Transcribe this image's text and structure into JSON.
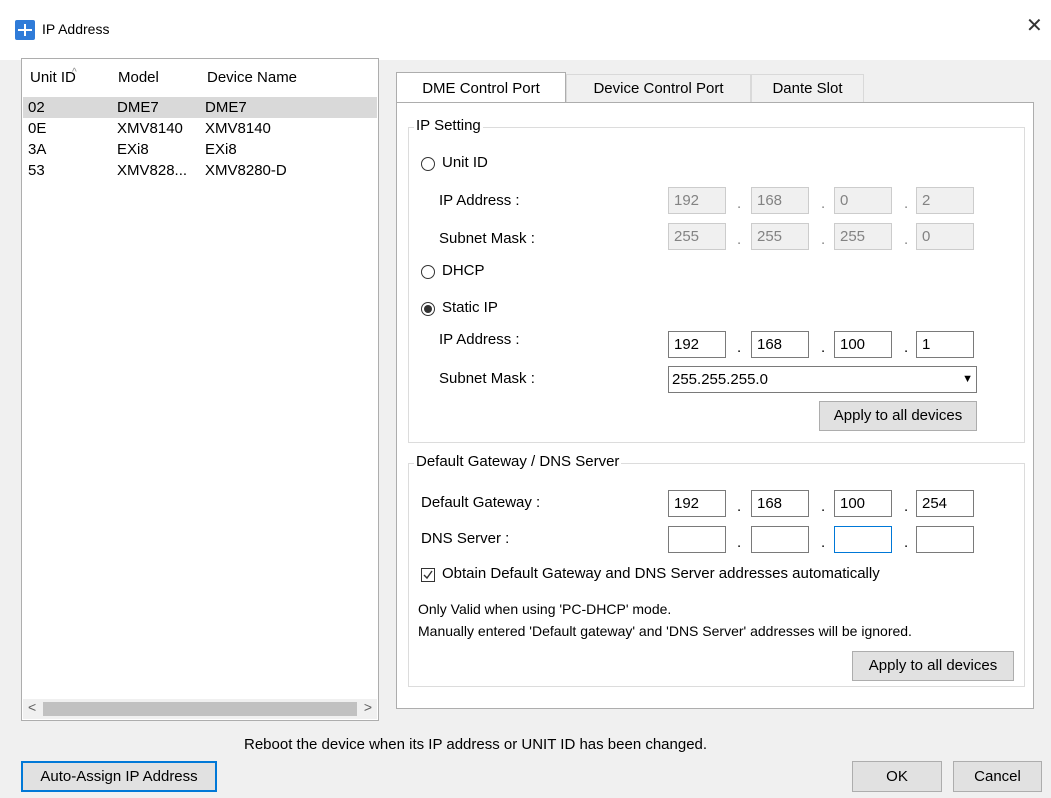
{
  "window": {
    "title": "IP Address",
    "close_glyph": "✕"
  },
  "list": {
    "headers": {
      "unit_id": "Unit ID",
      "model": "Model",
      "device_name": "Device Name"
    },
    "rows": [
      {
        "unit_id": "02",
        "model": "DME7",
        "device_name": "DME7",
        "selected": true
      },
      {
        "unit_id": "0E",
        "model": "XMV8140",
        "device_name": "XMV8140"
      },
      {
        "unit_id": "3A",
        "model": "EXi8",
        "device_name": "EXi8"
      },
      {
        "unit_id": "53",
        "model": "XMV828...",
        "device_name": "XMV8280-D"
      }
    ],
    "scroll_left": "<",
    "scroll_right": ">"
  },
  "tabs": [
    "DME Control Port",
    "Device Control Port",
    "Dante Slot"
  ],
  "ip_setting": {
    "legend": "IP Setting",
    "unit_id_label": "Unit ID",
    "unit_id_ip_label": "IP Address :",
    "unit_id_ip": [
      "192",
      "168",
      "0",
      "2"
    ],
    "unit_id_mask_label": "Subnet Mask :",
    "unit_id_mask": [
      "255",
      "255",
      "255",
      "0"
    ],
    "dhcp_label": "DHCP",
    "static_label": "Static IP",
    "static_ip_label": "IP Address :",
    "static_ip": [
      "192",
      "168",
      "100",
      "1"
    ],
    "static_mask_label": "Subnet Mask :",
    "static_mask": "255.255.255.0",
    "apply_label": "Apply to all devices",
    "selected_mode": "Static IP"
  },
  "gateway": {
    "legend": "Default Gateway / DNS Server",
    "gateway_label": "Default Gateway :",
    "gateway_ip": [
      "192",
      "168",
      "100",
      "254"
    ],
    "dns_label": "DNS Server :",
    "dns_ip": [
      "",
      "",
      "",
      ""
    ],
    "auto_label": "Obtain Default Gateway and DNS Server addresses automatically",
    "auto_checked": true,
    "note1": "Only Valid when using 'PC-DHCP' mode.",
    "note2": "Manually entered 'Default gateway' and 'DNS Server' addresses will be ignored.",
    "apply_label": "Apply to all devices"
  },
  "footer": {
    "reboot_note": "Reboot the device when its IP address or UNIT ID has been changed.",
    "auto_assign_label": "Auto-Assign IP Address",
    "ok_label": "OK",
    "cancel_label": "Cancel"
  },
  "colors": {
    "accent": "#0078d7",
    "selected_row": "#d9d9d9",
    "app_icon": "#2f7bd8"
  }
}
